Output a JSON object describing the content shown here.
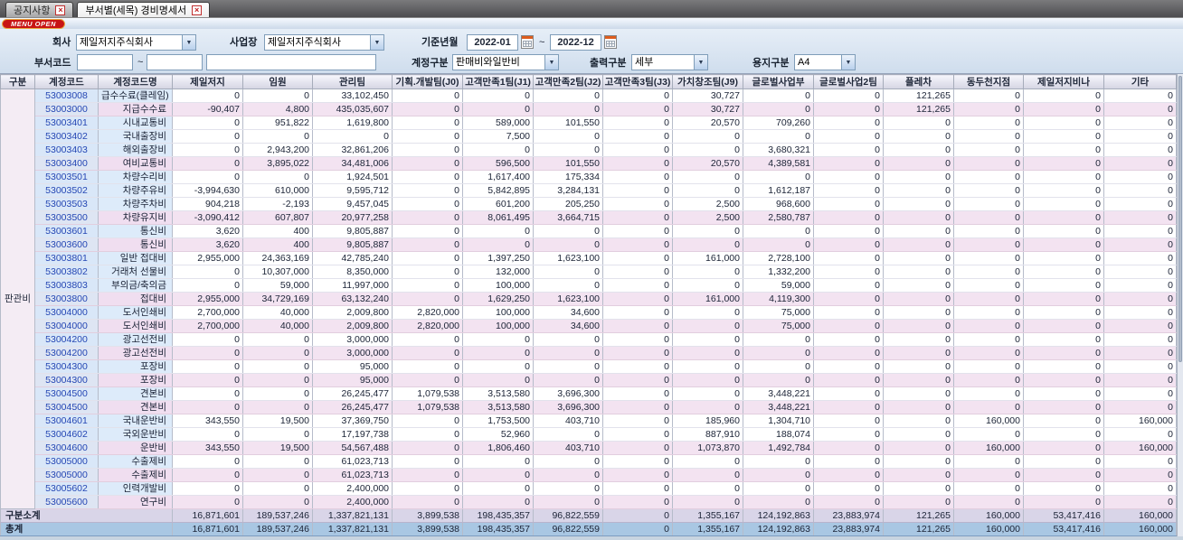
{
  "window": {
    "menu_open_label": "MENU OPEN"
  },
  "tabs": [
    {
      "label": "공지사항"
    },
    {
      "label": "부서별(세목) 경비명세서"
    }
  ],
  "filters": {
    "company": {
      "label": "회사",
      "value": "제일저지주식회사"
    },
    "site": {
      "label": "사업장",
      "value": "제일저지주식회사"
    },
    "period": {
      "label": "기준년월",
      "from": "2022-01",
      "separator": "~",
      "to": "2022-12"
    },
    "dept_code": {
      "label": "부서코드",
      "from": "",
      "separator": "~",
      "to": "",
      "name": ""
    },
    "account_type": {
      "label": "계정구분",
      "value": "판매비와일반비"
    },
    "output_type": {
      "label": "출력구분",
      "value": "세부"
    },
    "paper_type": {
      "label": "용지구분",
      "value": "A4"
    }
  },
  "table": {
    "headers": [
      "구분",
      "계정코드",
      "계정코드명",
      "제일저지",
      "임원",
      "관리팀",
      "기획.개발팀(J0)",
      "고객만족1팀(J1)",
      "고객만족2팀(J2)",
      "고객만족3팀(J3)",
      "가치창조팀(J9)",
      "글로벌사업부",
      "글로벌사업2팀",
      "플레차",
      "동두천지점",
      "제일저지비나",
      "기타"
    ],
    "group_label": "판관비",
    "rows": [
      {
        "code": "53003008",
        "name": "급수수료(클레임)",
        "subtotal": false,
        "values": [
          "0",
          "0",
          "33,102,450",
          "0",
          "0",
          "0",
          "0",
          "30,727",
          "0",
          "0",
          "121,265",
          "0",
          "0",
          "0"
        ]
      },
      {
        "code": "53003000",
        "name": "지급수수료",
        "subtotal": true,
        "values": [
          "-90,407",
          "4,800",
          "435,035,607",
          "0",
          "0",
          "0",
          "0",
          "30,727",
          "0",
          "0",
          "121,265",
          "0",
          "0",
          "0"
        ]
      },
      {
        "code": "53003401",
        "name": "시내교통비",
        "subtotal": false,
        "values": [
          "0",
          "951,822",
          "1,619,800",
          "0",
          "589,000",
          "101,550",
          "0",
          "20,570",
          "709,260",
          "0",
          "0",
          "0",
          "0",
          "0"
        ]
      },
      {
        "code": "53003402",
        "name": "국내출장비",
        "subtotal": false,
        "values": [
          "0",
          "0",
          "0",
          "0",
          "7,500",
          "0",
          "0",
          "0",
          "0",
          "0",
          "0",
          "0",
          "0",
          "0"
        ]
      },
      {
        "code": "53003403",
        "name": "해외출장비",
        "subtotal": false,
        "values": [
          "0",
          "2,943,200",
          "32,861,206",
          "0",
          "0",
          "0",
          "0",
          "0",
          "3,680,321",
          "0",
          "0",
          "0",
          "0",
          "0"
        ]
      },
      {
        "code": "53003400",
        "name": "여비교통비",
        "subtotal": true,
        "values": [
          "0",
          "3,895,022",
          "34,481,006",
          "0",
          "596,500",
          "101,550",
          "0",
          "20,570",
          "4,389,581",
          "0",
          "0",
          "0",
          "0",
          "0"
        ]
      },
      {
        "code": "53003501",
        "name": "차량수리비",
        "subtotal": false,
        "values": [
          "0",
          "0",
          "1,924,501",
          "0",
          "1,617,400",
          "175,334",
          "0",
          "0",
          "0",
          "0",
          "0",
          "0",
          "0",
          "0"
        ]
      },
      {
        "code": "53003502",
        "name": "차량주유비",
        "subtotal": false,
        "values": [
          "-3,994,630",
          "610,000",
          "9,595,712",
          "0",
          "5,842,895",
          "3,284,131",
          "0",
          "0",
          "1,612,187",
          "0",
          "0",
          "0",
          "0",
          "0"
        ]
      },
      {
        "code": "53003503",
        "name": "차량주차비",
        "subtotal": false,
        "values": [
          "904,218",
          "-2,193",
          "9,457,045",
          "0",
          "601,200",
          "205,250",
          "0",
          "2,500",
          "968,600",
          "0",
          "0",
          "0",
          "0",
          "0"
        ]
      },
      {
        "code": "53003500",
        "name": "차량유지비",
        "subtotal": true,
        "values": [
          "-3,090,412",
          "607,807",
          "20,977,258",
          "0",
          "8,061,495",
          "3,664,715",
          "0",
          "2,500",
          "2,580,787",
          "0",
          "0",
          "0",
          "0",
          "0"
        ]
      },
      {
        "code": "53003601",
        "name": "통신비",
        "subtotal": false,
        "values": [
          "3,620",
          "400",
          "9,805,887",
          "0",
          "0",
          "0",
          "0",
          "0",
          "0",
          "0",
          "0",
          "0",
          "0",
          "0"
        ]
      },
      {
        "code": "53003600",
        "name": "통신비",
        "subtotal": true,
        "values": [
          "3,620",
          "400",
          "9,805,887",
          "0",
          "0",
          "0",
          "0",
          "0",
          "0",
          "0",
          "0",
          "0",
          "0",
          "0"
        ]
      },
      {
        "code": "53003801",
        "name": "일반 접대비",
        "subtotal": false,
        "values": [
          "2,955,000",
          "24,363,169",
          "42,785,240",
          "0",
          "1,397,250",
          "1,623,100",
          "0",
          "161,000",
          "2,728,100",
          "0",
          "0",
          "0",
          "0",
          "0"
        ]
      },
      {
        "code": "53003802",
        "name": "거래처 선물비",
        "subtotal": false,
        "values": [
          "0",
          "10,307,000",
          "8,350,000",
          "0",
          "132,000",
          "0",
          "0",
          "0",
          "1,332,200",
          "0",
          "0",
          "0",
          "0",
          "0"
        ]
      },
      {
        "code": "53003803",
        "name": "부의금/축의금",
        "subtotal": false,
        "values": [
          "0",
          "59,000",
          "11,997,000",
          "0",
          "100,000",
          "0",
          "0",
          "0",
          "59,000",
          "0",
          "0",
          "0",
          "0",
          "0"
        ]
      },
      {
        "code": "53003800",
        "name": "접대비",
        "subtotal": true,
        "values": [
          "2,955,000",
          "34,729,169",
          "63,132,240",
          "0",
          "1,629,250",
          "1,623,100",
          "0",
          "161,000",
          "4,119,300",
          "0",
          "0",
          "0",
          "0",
          "0"
        ]
      },
      {
        "code": "53004000",
        "name": "도서인쇄비",
        "subtotal": false,
        "values": [
          "2,700,000",
          "40,000",
          "2,009,800",
          "2,820,000",
          "100,000",
          "34,600",
          "0",
          "0",
          "75,000",
          "0",
          "0",
          "0",
          "0",
          "0"
        ]
      },
      {
        "code": "53004000",
        "name": "도서인쇄비",
        "subtotal": true,
        "values": [
          "2,700,000",
          "40,000",
          "2,009,800",
          "2,820,000",
          "100,000",
          "34,600",
          "0",
          "0",
          "75,000",
          "0",
          "0",
          "0",
          "0",
          "0"
        ]
      },
      {
        "code": "53004200",
        "name": "광고선전비",
        "subtotal": false,
        "values": [
          "0",
          "0",
          "3,000,000",
          "0",
          "0",
          "0",
          "0",
          "0",
          "0",
          "0",
          "0",
          "0",
          "0",
          "0"
        ]
      },
      {
        "code": "53004200",
        "name": "광고선전비",
        "subtotal": true,
        "values": [
          "0",
          "0",
          "3,000,000",
          "0",
          "0",
          "0",
          "0",
          "0",
          "0",
          "0",
          "0",
          "0",
          "0",
          "0"
        ]
      },
      {
        "code": "53004300",
        "name": "포장비",
        "subtotal": false,
        "values": [
          "0",
          "0",
          "95,000",
          "0",
          "0",
          "0",
          "0",
          "0",
          "0",
          "0",
          "0",
          "0",
          "0",
          "0"
        ]
      },
      {
        "code": "53004300",
        "name": "포장비",
        "subtotal": true,
        "values": [
          "0",
          "0",
          "95,000",
          "0",
          "0",
          "0",
          "0",
          "0",
          "0",
          "0",
          "0",
          "0",
          "0",
          "0"
        ]
      },
      {
        "code": "53004500",
        "name": "견본비",
        "subtotal": false,
        "values": [
          "0",
          "0",
          "26,245,477",
          "1,079,538",
          "3,513,580",
          "3,696,300",
          "0",
          "0",
          "3,448,221",
          "0",
          "0",
          "0",
          "0",
          "0"
        ]
      },
      {
        "code": "53004500",
        "name": "견본비",
        "subtotal": true,
        "values": [
          "0",
          "0",
          "26,245,477",
          "1,079,538",
          "3,513,580",
          "3,696,300",
          "0",
          "0",
          "3,448,221",
          "0",
          "0",
          "0",
          "0",
          "0"
        ]
      },
      {
        "code": "53004601",
        "name": "국내운반비",
        "subtotal": false,
        "values": [
          "343,550",
          "19,500",
          "37,369,750",
          "0",
          "1,753,500",
          "403,710",
          "0",
          "185,960",
          "1,304,710",
          "0",
          "0",
          "160,000",
          "0",
          "160,000"
        ]
      },
      {
        "code": "53004602",
        "name": "국외운반비",
        "subtotal": false,
        "values": [
          "0",
          "0",
          "17,197,738",
          "0",
          "52,960",
          "0",
          "0",
          "887,910",
          "188,074",
          "0",
          "0",
          "0",
          "0",
          "0"
        ]
      },
      {
        "code": "53004600",
        "name": "운반비",
        "subtotal": true,
        "values": [
          "343,550",
          "19,500",
          "54,567,488",
          "0",
          "1,806,460",
          "403,710",
          "0",
          "1,073,870",
          "1,492,784",
          "0",
          "0",
          "160,000",
          "0",
          "160,000"
        ]
      },
      {
        "code": "53005000",
        "name": "수출제비",
        "subtotal": false,
        "values": [
          "0",
          "0",
          "61,023,713",
          "0",
          "0",
          "0",
          "0",
          "0",
          "0",
          "0",
          "0",
          "0",
          "0",
          "0"
        ]
      },
      {
        "code": "53005000",
        "name": "수출제비",
        "subtotal": true,
        "values": [
          "0",
          "0",
          "61,023,713",
          "0",
          "0",
          "0",
          "0",
          "0",
          "0",
          "0",
          "0",
          "0",
          "0",
          "0"
        ]
      },
      {
        "code": "53005602",
        "name": "인력개발비",
        "subtotal": false,
        "values": [
          "0",
          "0",
          "2,400,000",
          "0",
          "0",
          "0",
          "0",
          "0",
          "0",
          "0",
          "0",
          "0",
          "0",
          "0"
        ]
      },
      {
        "code": "53005600",
        "name": "연구비",
        "subtotal": true,
        "values": [
          "0",
          "0",
          "2,400,000",
          "0",
          "0",
          "0",
          "0",
          "0",
          "0",
          "0",
          "0",
          "0",
          "0",
          "0"
        ]
      }
    ],
    "subtotal": {
      "label": "구분소계",
      "values": [
        "16,871,601",
        "189,537,246",
        "1,337,821,131",
        "3,899,538",
        "198,435,357",
        "96,822,559",
        "0",
        "1,355,167",
        "124,192,863",
        "23,883,974",
        "121,265",
        "160,000",
        "53,417,416",
        "160,000"
      ]
    },
    "total": {
      "label": "총계",
      "values": [
        "16,871,601",
        "189,537,246",
        "1,337,821,131",
        "3,899,538",
        "198,435,357",
        "96,822,559",
        "0",
        "1,355,167",
        "124,192,863",
        "23,883,974",
        "121,265",
        "160,000",
        "53,417,416",
        "160,000"
      ]
    }
  }
}
